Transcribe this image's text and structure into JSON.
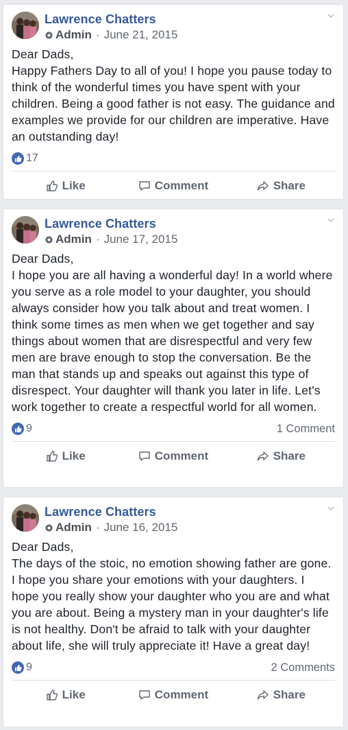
{
  "posts": [
    {
      "author": "Lawrence Chatters",
      "role": "Admin",
      "date": "June 21, 2015",
      "paragraphs": [
        "Dear Dads,",
        "Happy Fathers Day to all of you! I hope you pause today to think of the wonderful times you have spent with your children. Being a good father is not easy. The guidance and examples we provide for our children are imperative. Have an outstanding day!"
      ],
      "likes": "17",
      "comments": "",
      "actions": {
        "like": "Like",
        "comment": "Comment",
        "share": "Share"
      }
    },
    {
      "author": "Lawrence Chatters",
      "role": "Admin",
      "date": "June 17, 2015",
      "paragraphs": [
        "Dear Dads,",
        "I hope you are all having a wonderful day! In a world where you serve as a role model to your daughter, you should always consider how you talk about and treat women. I think some times as men when we get together and say things about women that are disrespectful and very few men are brave enough to stop the conversation. Be the man that stands up and speaks out against this type of disrespect. Your daughter will thank you later in life. Let's work together to create a respectful world for all women."
      ],
      "likes": "9",
      "comments": "1 Comment",
      "actions": {
        "like": "Like",
        "comment": "Comment",
        "share": "Share"
      }
    },
    {
      "author": "Lawrence Chatters",
      "role": "Admin",
      "date": "June 16, 2015",
      "paragraphs": [
        "Dear Dads,",
        "The days of the stoic, no emotion showing father are gone. I hope you share your emotions with your daughters. I hope you really show your daughter who you are and what you are about. Being a mystery man in your daughter's life is not healthy. Don't be afraid to talk with your daughter about life, she will truly appreciate it! Have a great day!"
      ],
      "likes": "9",
      "comments": "2 Comments",
      "actions": {
        "like": "Like",
        "comment": "Comment",
        "share": "Share"
      }
    }
  ],
  "colors": {
    "author": "#365899",
    "like_badge": "#4267b2",
    "background": "#e9ebee"
  },
  "icons": [
    "gear-icon",
    "chevron-down-icon",
    "thumbs-up-icon",
    "comment-icon",
    "share-icon"
  ]
}
